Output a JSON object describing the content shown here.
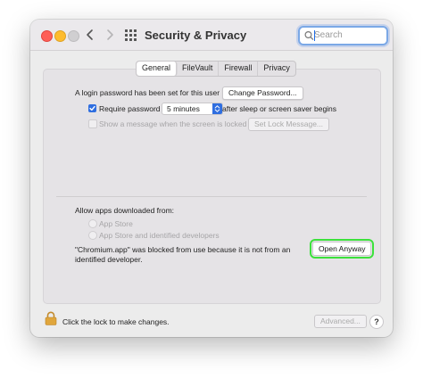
{
  "window": {
    "title": "Security & Privacy"
  },
  "search": {
    "placeholder": "Search"
  },
  "tabs": [
    {
      "label": "General",
      "active": true
    },
    {
      "label": "FileVault",
      "active": false
    },
    {
      "label": "Firewall",
      "active": false
    },
    {
      "label": "Privacy",
      "active": false
    }
  ],
  "general": {
    "login_password_text": "A login password has been set for this user",
    "change_password_button": "Change Password...",
    "require_password_label": "Require password",
    "require_password_checked": true,
    "require_password_delay": "5 minutes",
    "after_sleep_text": "after sleep or screen saver begins",
    "show_message_label": "Show a message when the screen is locked",
    "show_message_checked": false,
    "set_lock_message_button": "Set Lock Message..."
  },
  "apps": {
    "heading": "Allow apps downloaded from:",
    "options": [
      "App Store",
      "App Store and identified developers"
    ],
    "blocked_line1": "\"Chromium.app\" was blocked from use because it is not from an",
    "blocked_line2": "identified developer.",
    "open_anyway_button": "Open Anyway"
  },
  "footer": {
    "lock_text": "Click the lock to make changes.",
    "advanced_button": "Advanced...",
    "help_button": "?"
  },
  "colors": {
    "highlight": "#3ce13c",
    "accent": "#2f6ee0",
    "window_bg": "#ececec"
  },
  "icons": [
    "close-dot",
    "minimize-dot",
    "zoom-dot",
    "chevron-left-icon",
    "chevron-right-icon",
    "grid-icon",
    "search-icon",
    "checkmark-icon",
    "lock-icon"
  ]
}
